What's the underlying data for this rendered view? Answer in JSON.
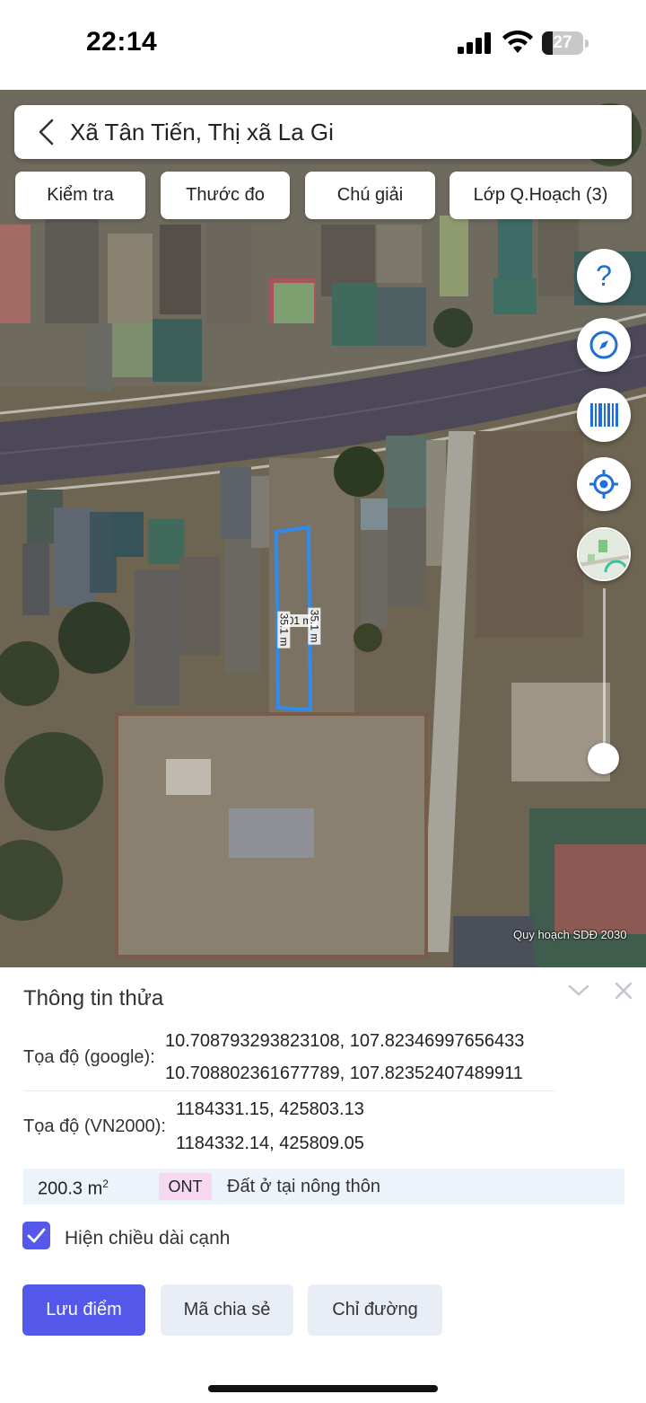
{
  "status_bar": {
    "time": "22:14",
    "battery_level": "27",
    "icons": [
      "cellular-signal-icon",
      "wifi-icon",
      "battery-icon"
    ]
  },
  "search": {
    "title": "Xã Tân Tiến, Thị xã La Gi",
    "back_icon": "chevron-left-icon"
  },
  "toolbar": {
    "chips": [
      "Kiểm tra",
      "Thước đo",
      "Chú giải",
      "Lớp Q.Hoạch (3)"
    ]
  },
  "map": {
    "side_buttons": [
      "help-icon",
      "compass-icon",
      "barcode-icon",
      "locate-icon",
      "layer-thumbnail"
    ],
    "parcel_outline_color": "#2e8cf0",
    "parcel_area_label": "201 m²",
    "parcel_side_left": "35.1 m",
    "parcel_side_right": "35.1 m",
    "watermark": "Quy hoạch SDĐ 2030",
    "opacity_slider_level": 0.9
  },
  "info_panel": {
    "title": "Thông tin thửa",
    "google_coords_label": "Tọa độ (google):",
    "google_coords": [
      "10.708793293823108, 107.82346997656433",
      "10.708802361677789, 107.82352407489911"
    ],
    "vn2000_coords_label": "Tọa độ (VN2000):",
    "vn2000_coords": [
      "1184331.15, 425803.13",
      "1184332.14, 425809.05"
    ],
    "area_value": "200.3 m",
    "area_unit_superscript": "2",
    "land_code": "ONT",
    "land_use": "Đất ở tại nông thôn",
    "show_edge_length_label": "Hiện chiều dài cạnh",
    "show_edge_length_checked": true,
    "buttons": {
      "save_point": "Lưu điểm",
      "share_code": "Mã chia sẻ",
      "directions": "Chỉ đường"
    }
  },
  "colors": {
    "accent": "#5358ea",
    "checkbox": "#5558e8",
    "icon_blue": "#1e6fd9",
    "area_row_bg": "#edf3fb",
    "badge_bg": "#f6d9f0"
  }
}
